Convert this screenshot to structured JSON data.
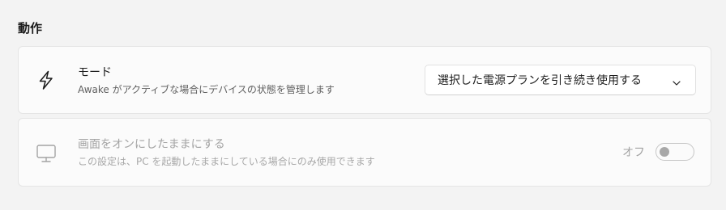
{
  "section": {
    "title": "動作"
  },
  "mode_card": {
    "icon": "lightning-icon",
    "title": "モード",
    "description": "Awake がアクティブな場合にデバイスの状態を管理します",
    "dropdown": {
      "selected": "選択した電源プランを引き続き使用する",
      "icon": "chevron-down-icon"
    }
  },
  "display_card": {
    "icon": "monitor-icon",
    "title": "画面をオンにしたままにする",
    "description": "この設定は、PC を起動したままにしている場合にのみ使用できます",
    "toggle": {
      "state_label": "オフ",
      "on": false,
      "enabled": false
    }
  },
  "colors": {
    "background": "#f3f3f3",
    "card": "#fbfbfb",
    "disabled_text": "#a3a3a3"
  }
}
